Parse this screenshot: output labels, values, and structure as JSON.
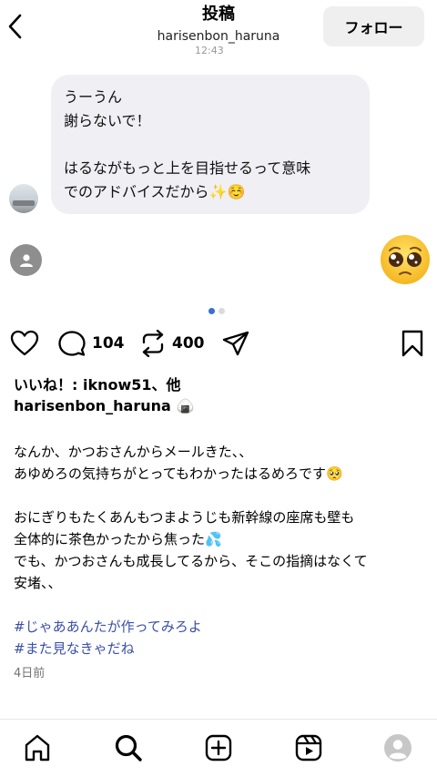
{
  "header": {
    "title": "投稿",
    "username": "harisenbon_haruna",
    "follow_label": "フォロー",
    "time_partial": "12:43"
  },
  "media": {
    "bubble_lines": [
      "うーうん",
      "謝らないで！",
      "",
      "はるながもっと上を目指せるって意味",
      "でのアドバイスだから✨☺️"
    ],
    "page_count": 2,
    "active_page": 1
  },
  "actions": {
    "comments": "104",
    "reposts": "400"
  },
  "caption": {
    "likes": "いいね！: iknow51、他",
    "author": "harisenbon_haruna",
    "author_emoji": "🍙",
    "lines": [
      "なんか、かつおさんからメールきた、、",
      "あゆめろの気持ちがとってもわかったはるめろです🥺",
      "",
      "おにぎりもたくあんもつまようじも新幹線の座席も壁も",
      "全体的に茶色かったから焦った💦",
      "でも、かつおさんも成長してるから、そこの指摘はなくて",
      "安堵、、",
      ""
    ],
    "hashtags": [
      "#じゃああんたが作ってみろよ",
      "#また見なきゃだね"
    ],
    "date": "4日前"
  },
  "icons": {
    "back": "chevron-left-icon",
    "like": "heart-icon",
    "comment": "comment-bubble-icon",
    "repost": "repost-icon",
    "share": "send-icon",
    "save": "bookmark-icon",
    "nav": [
      "home-icon",
      "search-icon",
      "create-icon",
      "reels-icon",
      "profile-icon"
    ]
  },
  "colors": {
    "accent": "#3b6fd4",
    "hashtag": "#3a4ea8",
    "bubble": "#efeff4",
    "follow_bg": "#efefef"
  }
}
